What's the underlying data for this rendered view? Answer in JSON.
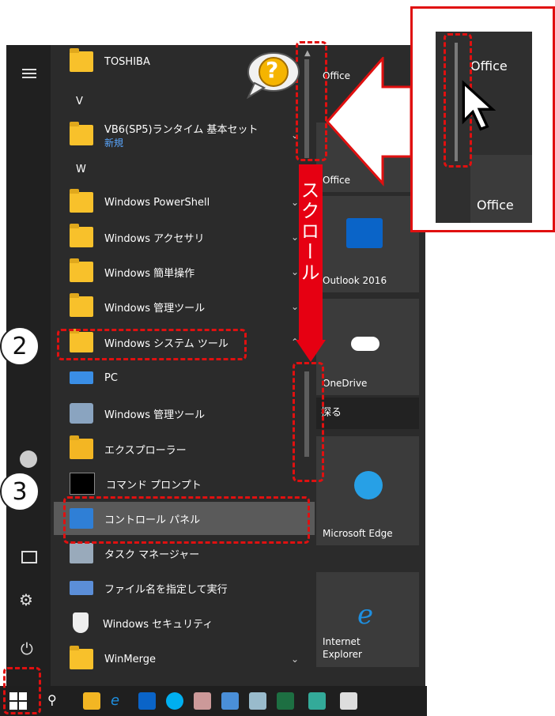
{
  "left_rail": {
    "menu_icon": "hamburger-icon",
    "user_icon": "user-icon",
    "pictures_icon": "pictures-icon",
    "settings_icon": "gear-icon",
    "power_icon": "power-icon"
  },
  "app_list": {
    "items": [
      {
        "label": "TOSHIBA"
      },
      {
        "label": "V"
      },
      {
        "label": "VB6(SP5)ランタイム 基本セット",
        "sub": "新規"
      },
      {
        "label": "W"
      },
      {
        "label": "Windows PowerShell"
      },
      {
        "label": "Windows アクセサリ"
      },
      {
        "label": "Windows 簡単操作"
      },
      {
        "label": "Windows 管理ツール"
      },
      {
        "label": "Windows システム ツール"
      },
      {
        "label": "PC"
      },
      {
        "label": "Windows 管理ツール"
      },
      {
        "label": "エクスプローラー"
      },
      {
        "label": "コマンド プロンプト"
      },
      {
        "label": "コントロール パネル"
      },
      {
        "label": "タスク マネージャー"
      },
      {
        "label": "ファイル名を指定して実行"
      },
      {
        "label": "Windows セキュリティ"
      },
      {
        "label": "WinMerge"
      }
    ]
  },
  "tiles": {
    "office_top": "Office",
    "office": "Office",
    "outlook": "Outlook 2016",
    "onedrive": "OneDrive",
    "section": "探る",
    "edge": "Microsoft Edge",
    "ie_line1": "Internet",
    "ie_line2": "Explorer"
  },
  "annotations": {
    "step2": "2",
    "step3": "3",
    "scroll_label": "スクロール",
    "question": "?",
    "callout_office_top": "Office",
    "callout_office_bottom": "Office"
  },
  "taskbar": {
    "icons": [
      "windows-start-icon",
      "search-icon",
      "file-explorer-icon",
      "ie-icon",
      "outlook-icon",
      "skype-icon",
      "paint-icon",
      "app-icon",
      "notepad-icon",
      "excel-icon",
      "network-icon",
      "other-app-icon"
    ]
  }
}
